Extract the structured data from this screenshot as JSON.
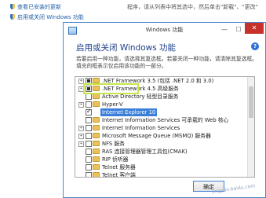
{
  "background": {
    "links": [
      "查看已安装的更新",
      "启用或关闭 Windows 功能"
    ],
    "right_text": "程序，请从列表中将其选中，然后单击\"卸载\"、\"更改\""
  },
  "dialog": {
    "window_title": "Windows 功能",
    "header_title": "启用或关闭 Windows 功能",
    "description": "若要启用一种功能，请选择其复选框。若要关闭一种功能，请清除其复选框。填充的框表示仅启用该功能的一部分。",
    "minimize": "—",
    "maximize": "☐",
    "close": "✕",
    "help": "?",
    "ok_label": "确定",
    "features": [
      {
        "label": ".NET Framework 3.5 (包括 .NET 2.0 和 3.0)",
        "state": "partial",
        "expandable": true,
        "folder": true,
        "selected": false
      },
      {
        "label": ".NET Framework 4.5 高级服务",
        "state": "partial",
        "expandable": true,
        "folder": true,
        "selected": false
      },
      {
        "label": "Active Directory 轻型目录服务",
        "state": "unchecked",
        "expandable": false,
        "folder": true,
        "selected": false
      },
      {
        "label": "Hyper-V",
        "state": "unchecked",
        "expandable": true,
        "folder": true,
        "selected": false
      },
      {
        "label": "Internet Explorer 10",
        "state": "checked",
        "expandable": false,
        "folder": false,
        "selected": true
      },
      {
        "label": "Internet Information Services 可承载的 Web 核心",
        "state": "unchecked",
        "expandable": false,
        "folder": true,
        "selected": false
      },
      {
        "label": "Internet Information Services",
        "state": "unchecked",
        "expandable": true,
        "folder": true,
        "selected": false
      },
      {
        "label": "Microsoft Message Queue (MSMQ) 服务器",
        "state": "unchecked",
        "expandable": true,
        "folder": true,
        "selected": false
      },
      {
        "label": "NFS 服务",
        "state": "unchecked",
        "expandable": true,
        "folder": true,
        "selected": false
      },
      {
        "label": "RAS 连接管理器管理工具包(CMAK)",
        "state": "unchecked",
        "expandable": false,
        "folder": true,
        "selected": false
      },
      {
        "label": "RIP 侦听器",
        "state": "unchecked",
        "expandable": false,
        "folder": true,
        "selected": false
      },
      {
        "label": "Telnet 服务器",
        "state": "unchecked",
        "expandable": false,
        "folder": true,
        "selected": false
      },
      {
        "label": "Telnet 客户端",
        "state": "unchecked",
        "expandable": false,
        "folder": true,
        "selected": false
      }
    ]
  },
  "watermark": "jingyan.baidu.com",
  "colors": {
    "accent": "#3b7fd9",
    "highlight": "#c6e64a",
    "close": "#c7312b",
    "title_text": "#1e3f8a"
  }
}
